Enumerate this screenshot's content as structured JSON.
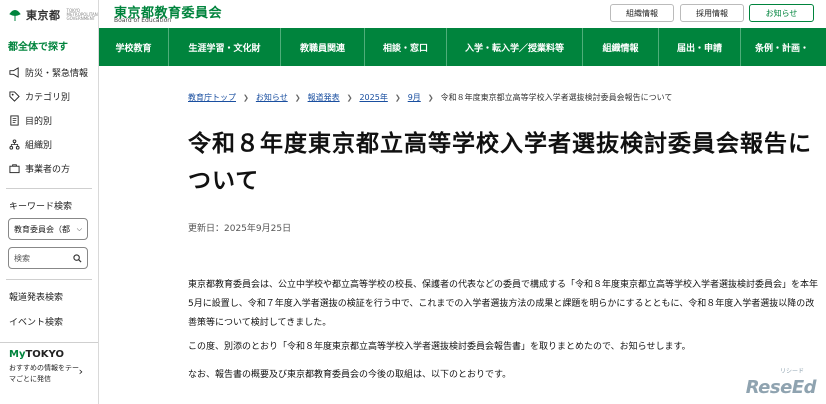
{
  "sidebar": {
    "logo_text": "東京都",
    "logo_small": "TOKYO METROPOLITAN GOVERNMENT",
    "search_all": "都全体で探す",
    "items": [
      {
        "label": "防災・緊急情報",
        "icon": "megaphone-icon"
      },
      {
        "label": "カテゴリ別",
        "icon": "tag-icon"
      },
      {
        "label": "目的別",
        "icon": "document-icon"
      },
      {
        "label": "組織別",
        "icon": "org-chart-icon"
      },
      {
        "label": "事業者の方",
        "icon": "briefcase-icon"
      }
    ],
    "keyword_label": "キーワード検索",
    "select_value": "教育委員会（都",
    "search_placeholder": "検索",
    "links": [
      "報道発表検索",
      "イベント検索"
    ],
    "mytokyo_my": "My",
    "mytokyo_tokyo": "TOKYO",
    "mytokyo_desc": "おすすめの情報をテーマごとに発信"
  },
  "header": {
    "title": "東京都教育委員会",
    "subtitle": "Board of Education",
    "buttons": [
      "組織情報",
      "採用情報",
      "お知らせ"
    ]
  },
  "nav": {
    "items": [
      "学校教育",
      "生涯学習・文化財",
      "教職員関連",
      "相談・窓口",
      "入学・転入学／授業料等",
      "組織情報",
      "届出・申請",
      "条例・計画・"
    ]
  },
  "breadcrumb": {
    "links": [
      "教育庁トップ",
      "お知らせ",
      "報道発表",
      "2025年",
      "9月"
    ],
    "current": "令和８年度東京都立高等学校入学者選抜検討委員会報告について"
  },
  "article": {
    "title": "令和８年度東京都立高等学校入学者選抜検討委員会報告について",
    "updated": "更新日：2025年9月25日",
    "paragraphs": [
      "東京都教育委員会は、公立中学校や都立高等学校の校長、保護者の代表などの委員で構成する「令和８年度東京都立高等学校入学者選抜検討委員会」を本年5月に設置し、令和７年度入学者選抜の検証を行う中で、これまでの入学者選抜方法の成果と課題を明らかにするとともに、令和８年度入学者選抜以降の改善策等について検討してきました。",
      "この度、別添のとおり「令和８年度東京都立高等学校入学者選抜検討委員会報告書」を取りまとめたので、お知らせします。",
      "なお、報告書の概要及び東京都教育委員会の今後の取組は、以下のとおりです。"
    ]
  },
  "watermark": {
    "text": "ReseEd",
    "small": "リシード"
  },
  "colors": {
    "brand_green": "#00843d",
    "link_blue": "#1a4fa0"
  }
}
